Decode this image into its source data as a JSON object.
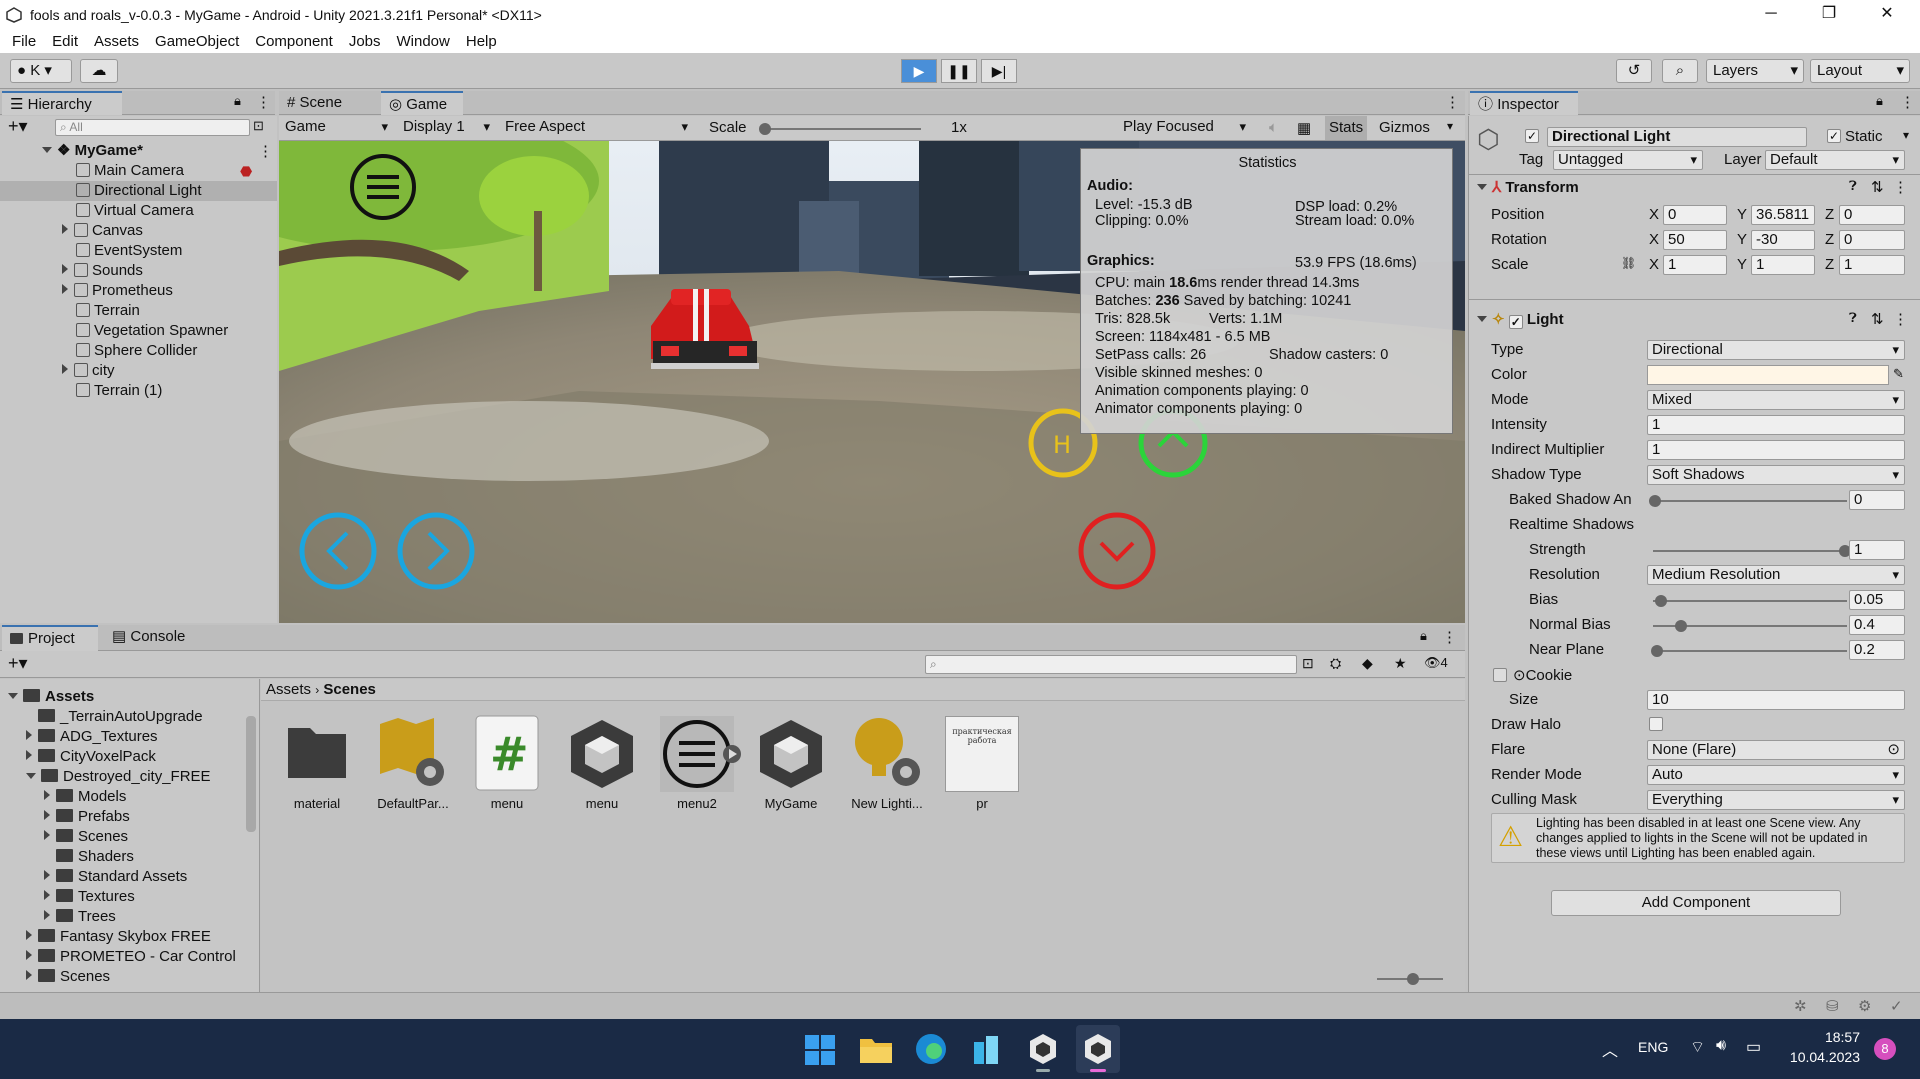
{
  "window": {
    "title": "fools and roals_v-0.0.3 - MyGame - Android - Unity 2021.3.21f1 Personal* <DX11>"
  },
  "menu": [
    "File",
    "Edit",
    "Assets",
    "GameObject",
    "Component",
    "Jobs",
    "Window",
    "Help"
  ],
  "toolbar": {
    "account": "K",
    "layers": "Layers",
    "layout": "Layout"
  },
  "hierarchy": {
    "tab": "Hierarchy",
    "search_placeholder": "All",
    "scene": "MyGame*",
    "items": [
      "Main Camera",
      "Directional Light",
      "Virtual Camera",
      "Canvas",
      "EventSystem",
      "Sounds",
      "Prometheus",
      "Terrain",
      "Vegetation Spawner",
      "Sphere Collider",
      "city",
      "Terrain (1)"
    ]
  },
  "gameview": {
    "tabs": [
      "Scene",
      "Game"
    ],
    "mode": "Game",
    "display": "Display 1",
    "aspect": "Free Aspect",
    "scale_label": "Scale",
    "scale_value": "1x",
    "play_focused": "Play Focused",
    "stats_btn": "Stats",
    "gizmos_btn": "Gizmos"
  },
  "stats": {
    "title": "Statistics",
    "audio_h": "Audio:",
    "level": "Level: -15.3 dB",
    "clipping": "Clipping: 0.0%",
    "dsp": "DSP load: 0.2%",
    "stream": "Stream load: 0.0%",
    "graphics_h": "Graphics:",
    "fps": "53.9 FPS (18.6ms)",
    "cpu_a": "CPU: main ",
    "cpu_b": "18.6",
    "cpu_c": "ms  render thread 14.3ms",
    "batches_a": "Batches: ",
    "batches_b": "236",
    "batches_c": "   Saved by batching: 10241",
    "tris": "Tris: 828.5k",
    "verts": "Verts: 1.1M",
    "screen": "Screen: 1184x481 - 6.5 MB",
    "setpass": "SetPass calls: 26",
    "shadow": "Shadow casters: 0",
    "skinned": "Visible skinned meshes: 0",
    "anim": "Animation components playing: 0",
    "animator": "Animator components playing: 0"
  },
  "inspector": {
    "tab": "Inspector",
    "object_name": "Directional Light",
    "static_label": "Static",
    "tag_label": "Tag",
    "tag_value": "Untagged",
    "layer_label": "Layer",
    "layer_value": "Default",
    "transform": {
      "title": "Transform",
      "position_label": "Position",
      "pos": [
        "0",
        "36.5811",
        "0"
      ],
      "rotation_label": "Rotation",
      "rot": [
        "50",
        "-30",
        "0"
      ],
      "scale_label": "Scale",
      "scl": [
        "1",
        "1",
        "1"
      ],
      "x": "X",
      "y": "Y",
      "z": "Z"
    },
    "light": {
      "title": "Light",
      "type_label": "Type",
      "type": "Directional",
      "color_label": "Color",
      "color": "#fff6e6",
      "mode_label": "Mode",
      "mode": "Mixed",
      "intensity_label": "Intensity",
      "intensity": "1",
      "indirect_label": "Indirect Multiplier",
      "indirect": "1",
      "shadow_type_label": "Shadow Type",
      "shadow_type": "Soft Shadows",
      "baked_label": "Baked Shadow An",
      "baked": "0",
      "realtime_label": "Realtime Shadows",
      "strength_label": "Strength",
      "strength": "1",
      "resolution_label": "Resolution",
      "resolution": "Medium Resolution",
      "bias_label": "Bias",
      "bias": "0.05",
      "normal_bias_label": "Normal Bias",
      "normal_bias": "0.4",
      "near_plane_label": "Near Plane",
      "near_plane": "0.2",
      "cookie_label": "Cookie",
      "size_label": "Size",
      "size": "10",
      "halo_label": "Draw Halo",
      "flare_label": "Flare",
      "flare": "None (Flare)",
      "render_mode_label": "Render Mode",
      "render_mode": "Auto",
      "culling_label": "Culling Mask",
      "culling": "Everything",
      "warning": "Lighting has been disabled in at least one Scene view. Any changes applied to lights in the Scene will not be updated in these views until Lighting has been enabled again."
    },
    "add_component": "Add Component"
  },
  "project": {
    "tabs": [
      "Project",
      "Console"
    ],
    "hidden_count": "4",
    "breadcrumb": [
      "Assets",
      "Scenes"
    ],
    "tree": [
      {
        "label": "Assets",
        "depth": 0,
        "open": true,
        "bold": true
      },
      {
        "label": "_TerrainAutoUpgrade",
        "depth": 1,
        "open": null
      },
      {
        "label": "ADG_Textures",
        "depth": 1,
        "open": false
      },
      {
        "label": "CityVoxelPack",
        "depth": 1,
        "open": false
      },
      {
        "label": "Destroyed_city_FREE",
        "depth": 1,
        "open": true
      },
      {
        "label": "Models",
        "depth": 2,
        "open": false
      },
      {
        "label": "Prefabs",
        "depth": 2,
        "open": false
      },
      {
        "label": "Scenes",
        "depth": 2,
        "open": false
      },
      {
        "label": "Shaders",
        "depth": 2,
        "open": null
      },
      {
        "label": "Standard Assets",
        "depth": 2,
        "open": false
      },
      {
        "label": "Textures",
        "depth": 2,
        "open": false
      },
      {
        "label": "Trees",
        "depth": 2,
        "open": false
      },
      {
        "label": "Fantasy Skybox FREE",
        "depth": 1,
        "open": false
      },
      {
        "label": "PROMETEO - Car Control",
        "depth": 1,
        "open": false
      },
      {
        "label": "Scenes",
        "depth": 1,
        "open": false
      }
    ],
    "assets": [
      "material",
      "DefaultPar...",
      "menu",
      "menu",
      "menu2",
      "MyGame",
      "New Lighti...",
      "pr"
    ],
    "pr_thumb_text": "практическая работа"
  },
  "taskbar": {
    "lang": "ENG",
    "time": "18:57",
    "date": "10.04.2023",
    "badge": "8"
  }
}
